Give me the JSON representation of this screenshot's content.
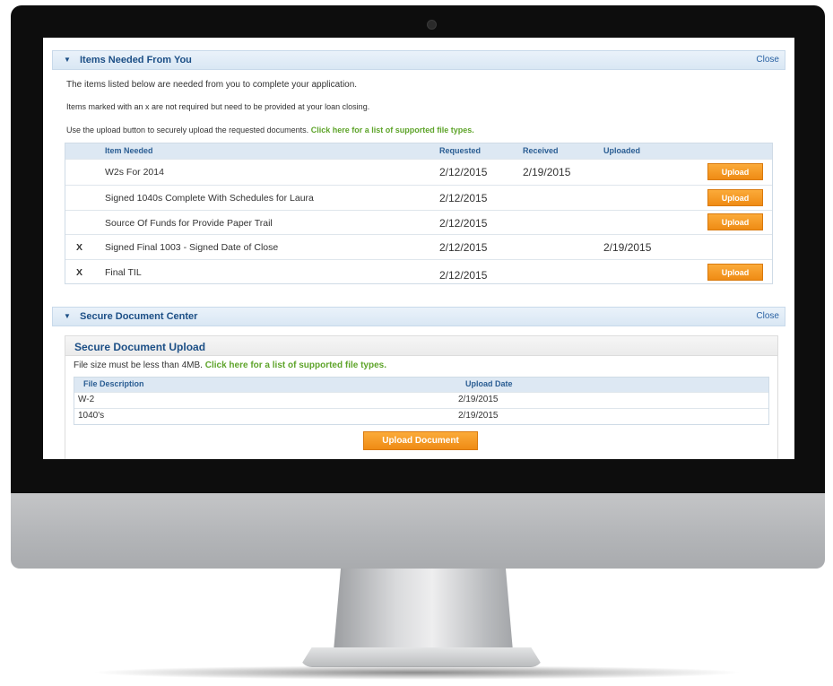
{
  "items_panel": {
    "title": "Items Needed From You",
    "close_label": "Close",
    "intro": "The items listed below are needed from you to complete your application.",
    "note": "Items marked with an x are not required but need to be provided at your loan closing.",
    "upload_hint": "Use the upload button to securely upload the requested documents.",
    "file_types_link": "Click here for a list of supported file types.",
    "columns": {
      "item": "Item Needed",
      "requested": "Requested",
      "received": "Received",
      "uploaded": "Uploaded"
    },
    "rows": [
      {
        "mark": "",
        "item": "W2s For 2014",
        "requested": "2/12/2015",
        "received": "2/19/2015",
        "uploaded": "",
        "action": "Upload"
      },
      {
        "mark": "",
        "item": "Signed 1040s Complete With Schedules for Laura",
        "requested": "2/12/2015",
        "received": "",
        "uploaded": "",
        "action": "Upload"
      },
      {
        "mark": "",
        "item": "Source Of Funds for Provide Paper Trail",
        "requested": "2/12/2015",
        "received": "",
        "uploaded": "",
        "action": "Upload"
      },
      {
        "mark": "X",
        "item": "Signed Final 1003 - Signed Date of Close",
        "requested": "2/12/2015",
        "received": "",
        "uploaded": "2/19/2015",
        "action": ""
      },
      {
        "mark": "X",
        "item": "Final TIL",
        "requested": "2/12/2015",
        "received": "",
        "uploaded": "",
        "action": "Upload"
      }
    ]
  },
  "doc_center": {
    "title": "Secure Document Center",
    "close_label": "Close",
    "upload_title": "Secure Document Upload",
    "size_note": "File size must be less than 4MB.",
    "file_types_link": "Click here for a list of supported file types.",
    "columns": {
      "description": "File Description",
      "date": "Upload Date"
    },
    "files": [
      {
        "description": "W-2",
        "date": "2/19/2015"
      },
      {
        "description": "1040's",
        "date": "2/19/2015"
      }
    ],
    "upload_button": "Upload Document"
  },
  "icons": {
    "collapse": "triangle-down-icon"
  },
  "colors": {
    "accent_orange": "#f29a22",
    "link_green": "#5ea42a",
    "header_blue": "#1c4f86"
  }
}
